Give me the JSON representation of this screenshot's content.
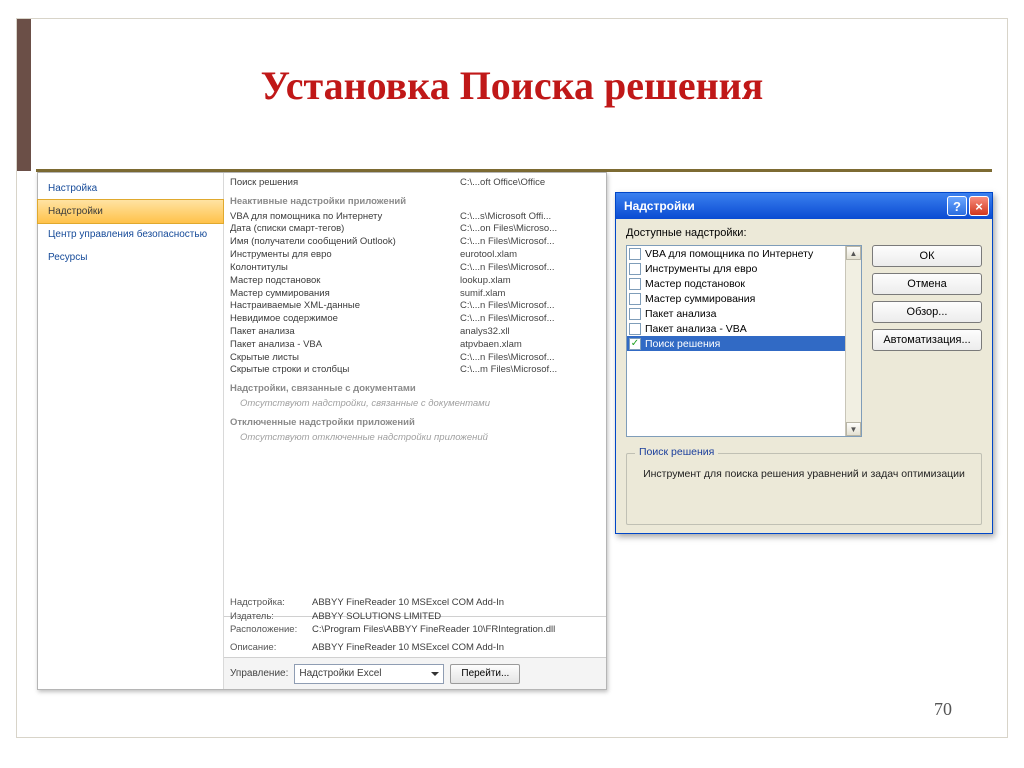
{
  "slide": {
    "title": "Установка Поиска решения",
    "page_number": "70"
  },
  "excel_options": {
    "sidebar": [
      {
        "label": "Настройка",
        "selected": false
      },
      {
        "label": "Надстройки",
        "selected": true
      },
      {
        "label": "Центр управления безопасностью",
        "selected": false
      },
      {
        "label": "Ресурсы",
        "selected": false
      }
    ],
    "top_rows": [
      {
        "name": "Поиск решения",
        "path": "C:\\...oft Office\\Office"
      }
    ],
    "inactive_header": "Неактивные надстройки приложений",
    "inactive_rows": [
      {
        "name": "VBA для помощника по Интернету",
        "path": "C:\\...s\\Microsoft Offi..."
      },
      {
        "name": "Дата (списки смарт-тегов)",
        "path": "C:\\...on Files\\Microso..."
      },
      {
        "name": "Имя (получатели сообщений Outlook)",
        "path": "C:\\...n Files\\Microsof..."
      },
      {
        "name": "Инструменты для евро",
        "path": "eurotool.xlam"
      },
      {
        "name": "Колонтитулы",
        "path": "C:\\...n Files\\Microsof..."
      },
      {
        "name": "Мастер подстановок",
        "path": "lookup.xlam"
      },
      {
        "name": "Мастер суммирования",
        "path": "sumif.xlam"
      },
      {
        "name": "Настраиваемые XML-данные",
        "path": "C:\\...n Files\\Microsof..."
      },
      {
        "name": "Невидимое содержимое",
        "path": "C:\\...n Files\\Microsof..."
      },
      {
        "name": "Пакет анализа",
        "path": "analys32.xll"
      },
      {
        "name": "Пакет анализа - VBA",
        "path": "atpvbaen.xlam"
      },
      {
        "name": "Скрытые листы",
        "path": "C:\\...n Files\\Microsof..."
      },
      {
        "name": "Скрытые строки и столбцы",
        "path": "C:\\...m Files\\Microsof..."
      }
    ],
    "doc_header": "Надстройки, связанные с документами",
    "doc_empty": "Отсутствуют надстройки, связанные с документами",
    "disabled_header": "Отключенные надстройки приложений",
    "disabled_empty": "Отсутствуют отключенные надстройки приложений",
    "details": {
      "addin_label": "Надстройка:",
      "addin_value": "ABBYY FineReader 10 MSExcel COM Add-In",
      "publisher_label": "Издатель:",
      "publisher_value": "ABBYY SOLUTIONS LIMITED",
      "location_label": "Расположение:",
      "location_value": "C:\\Program Files\\ABBYY FineReader 10\\FRIntegration.dll",
      "desc_label": "Описание:",
      "desc_value": "ABBYY FineReader 10 MSExcel COM Add-In"
    },
    "footer": {
      "manage_label": "Управление:",
      "combo_value": "Надстройки Excel",
      "go_label": "Перейти..."
    }
  },
  "addins_dialog": {
    "title": "Надстройки",
    "available_label": "Доступные надстройки:",
    "items": [
      {
        "label": "VBA для помощника по Интернету",
        "checked": false,
        "selected": false
      },
      {
        "label": "Инструменты для евро",
        "checked": false,
        "selected": false
      },
      {
        "label": "Мастер подстановок",
        "checked": false,
        "selected": false
      },
      {
        "label": "Мастер суммирования",
        "checked": false,
        "selected": false
      },
      {
        "label": "Пакет анализа",
        "checked": false,
        "selected": false
      },
      {
        "label": "Пакет анализа - VBA",
        "checked": false,
        "selected": false
      },
      {
        "label": "Поиск решения",
        "checked": true,
        "selected": true
      }
    ],
    "buttons": {
      "ok": "ОК",
      "cancel": "Отмена",
      "browse": "Обзор...",
      "automation": "Автоматизация..."
    },
    "group_legend": "Поиск решения",
    "group_text": "Инструмент для поиска решения уравнений и задач оптимизации"
  }
}
